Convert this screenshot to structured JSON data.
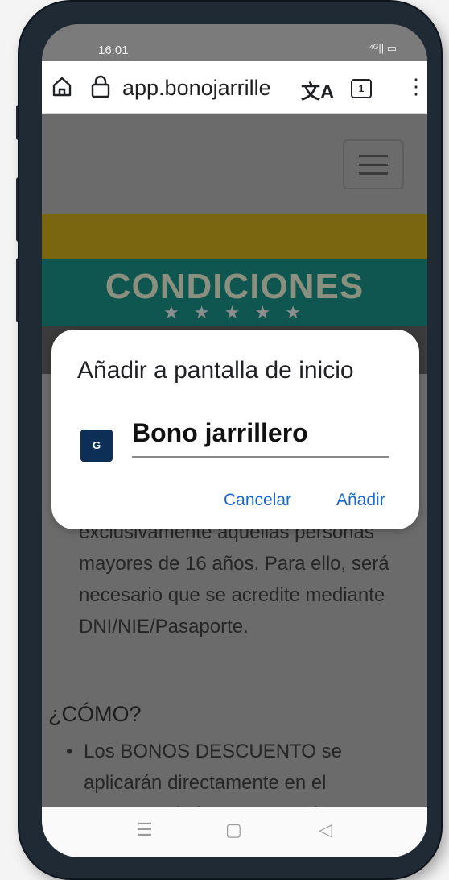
{
  "status": {
    "time": "16:01",
    "signal": "⁴ᴳ|| ▭"
  },
  "browser": {
    "url": "app.bonojarrille",
    "translate_icon": "文A",
    "tab_count": "1",
    "menu_icon": "⋮"
  },
  "page": {
    "banner_title": "CONDICIONES",
    "banner_stars": "★ ★ ★ ★ ★",
    "body_text": "exclusivamente aquellas personas mayores de 16 años. Para ello, será necesario que se acredite mediante DNI/NIE/Pasaporte.",
    "how_heading": "¿CÓMO?",
    "bullet": "Los BONOS DESCUENTO se aplicarán directamente en el momento de la compra en los"
  },
  "dialog": {
    "title": "Añadir a pantalla de inicio",
    "app_icon_letter": "G",
    "app_name": "Bono jarrillero",
    "cancel_label": "Cancelar",
    "add_label": "Añadir"
  },
  "navbar": {
    "menu": "☰",
    "home": "▢",
    "back": "◁"
  }
}
